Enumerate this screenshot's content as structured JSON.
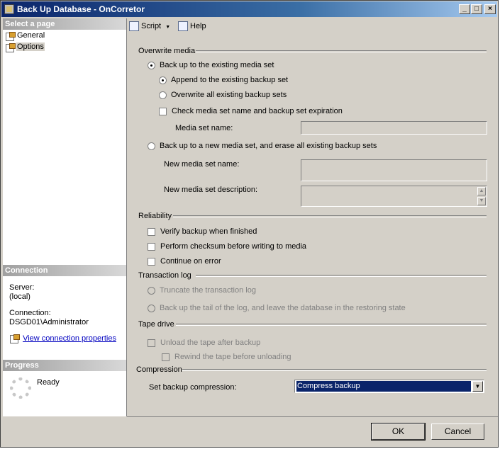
{
  "window": {
    "title": "Back Up Database - OnCorretor"
  },
  "title_buttons": {
    "minimize": "_",
    "maximize": "□",
    "close": "×"
  },
  "sidebar": {
    "select_page_header": "Select a page",
    "pages": [
      {
        "label": "General"
      },
      {
        "label": "Options"
      }
    ],
    "connection_header": "Connection",
    "server_label": "Server:",
    "server_value": "(local)",
    "connection_label": "Connection:",
    "connection_value": "DSGD01\\Administrator",
    "view_connection_link": "View connection properties",
    "progress_header": "Progress",
    "progress_status": "Ready"
  },
  "toolbar": {
    "script_label": "Script",
    "help_label": "Help"
  },
  "overwrite_media": {
    "title": "Overwrite media",
    "existing_set": "Back up to the existing media set",
    "append": "Append to the existing backup set",
    "overwrite_all": "Overwrite all existing backup sets",
    "check_expiration": "Check media set name and backup set expiration",
    "media_set_name_label": "Media set name:",
    "new_set": "Back up to a new media set, and erase all existing backup sets",
    "new_name_label": "New media set name:",
    "new_desc_label": "New media set description:"
  },
  "reliability": {
    "title": "Reliability",
    "verify": "Verify backup when finished",
    "checksum": "Perform checksum before writing to media",
    "continue_on_error": "Continue on error"
  },
  "transaction_log": {
    "title": "Transaction log",
    "truncate": "Truncate the transaction log",
    "tail": "Back up the tail of the log, and leave the database in the restoring state"
  },
  "tape_drive": {
    "title": "Tape drive",
    "unload": "Unload the tape after backup",
    "rewind": "Rewind the tape before unloading"
  },
  "compression": {
    "title": "Compression",
    "label": "Set backup compression:",
    "selected": "Compress backup"
  },
  "buttons": {
    "ok": "OK",
    "cancel": "Cancel"
  }
}
